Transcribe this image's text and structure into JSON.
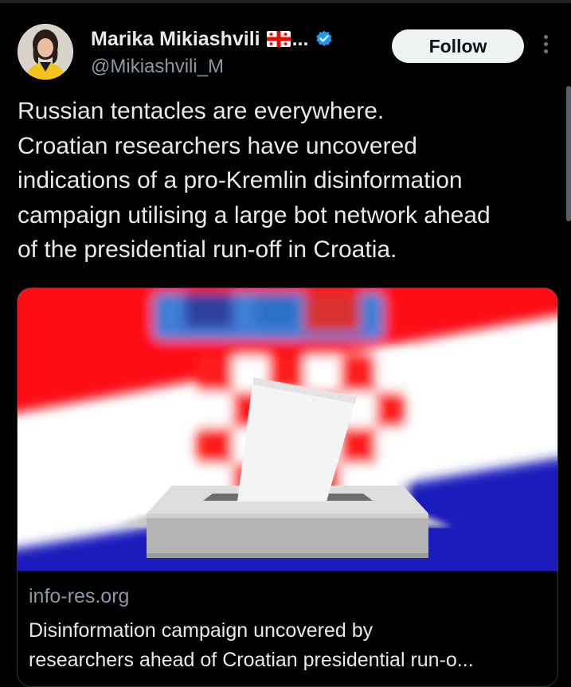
{
  "author": {
    "display_name": "Marika Mikiashvili",
    "ellipsis": "...",
    "handle": "@Mikiashvili_M"
  },
  "actions": {
    "follow_label": "Follow"
  },
  "tweet": {
    "text_lines": [
      "Russian tentacles are everywhere.",
      "Croatian researchers have uncovered",
      "indications of a pro-Kremlin disinformation",
      "campaign utilising a large bot network ahead",
      "of the presidential run-off in Croatia."
    ]
  },
  "link_card": {
    "domain": "info-res.org",
    "title_lines": [
      "Disinformation campaign uncovered by",
      "researchers ahead of Croatian presidential run-o..."
    ]
  },
  "colors": {
    "background": "#000000",
    "text_primary": "#e7e9ea",
    "text_secondary": "#8b98a5",
    "verified_blue": "#1d9bf0",
    "follow_bg": "#eff3f4",
    "flag_red": "#ff0a12",
    "flag_blue": "#1a1fbd"
  },
  "icons": {
    "flag": "georgian-flag-icon",
    "verified": "verified-badge-icon",
    "more": "more-vertical-icon",
    "avatar": "profile-photo",
    "card_image": "croatian-flag-ballot-box-image"
  }
}
